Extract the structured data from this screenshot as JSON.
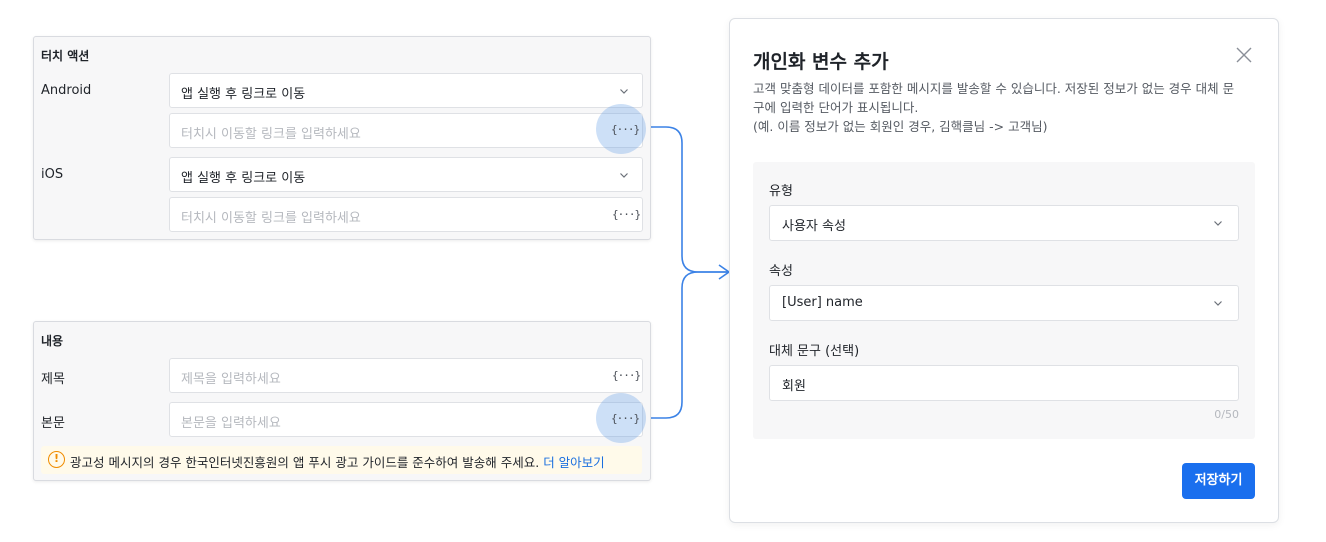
{
  "touch_action": {
    "title": "터치 액션",
    "android": {
      "label": "Android",
      "action_value": "앱 실행 후 링크로 이동",
      "link_placeholder": "터치시 이동할 링크를 입력하세요"
    },
    "ios": {
      "label": "iOS",
      "action_value": "앱 실행 후 링크로 이동",
      "link_placeholder": "터치시 이동할 링크를 입력하세요"
    }
  },
  "content": {
    "title": "내용",
    "subject_label": "제목",
    "subject_placeholder": "제목을 입력하세요",
    "body_label": "본문",
    "body_placeholder": "본문을 입력하세요",
    "notice_text": "광고성 메시지의 경우 한국인터넷진흥원의 앱 푸시 광고 가이드를 준수하여 발송해 주세요.",
    "notice_link": "더 알아보기",
    "notice_icon": "!"
  },
  "variable_button_glyph": "{···}",
  "modal": {
    "title": "개인화 변수 추가",
    "description_line1": "고객 맞춤형 데이터를 포함한 메시지를 발송할 수 있습니다. 저장된 정보가 없는 경우 대체 문",
    "description_line2": "구에 입력한 단어가 표시됩니다.",
    "description_line3": "(예. 이름 정보가 없는 회원인 경우, 김핵클님 -> 고객님)",
    "type_label": "유형",
    "type_value": "사용자 속성",
    "attribute_label": "속성",
    "attribute_value": "[User] name",
    "fallback_label": "대체 문구 (선택)",
    "fallback_value": "회원",
    "counter": "0/50",
    "save_label": "저장하기"
  },
  "colors": {
    "accent": "#1a6fee",
    "link": "#1a6fdf",
    "connector": "#3b82e6",
    "warning": "#f08c00"
  }
}
